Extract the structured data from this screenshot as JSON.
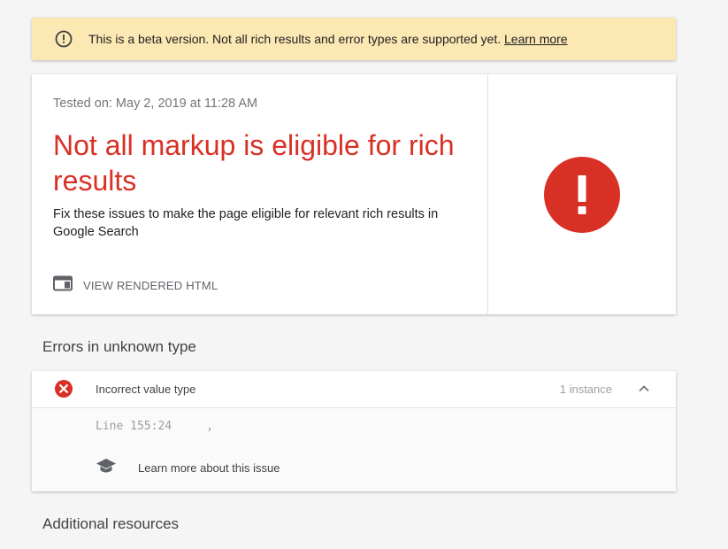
{
  "banner": {
    "icon": "warning-circle-icon",
    "text": "This is a beta version. Not all rich results and error types are supported yet.",
    "link_label": "Learn more"
  },
  "result": {
    "tested_on": "Tested on: May 2, 2019 at 11:28 AM",
    "headline": "Not all markup is eligible for rich results",
    "description": "Fix these issues to make the page eligible for relevant rich results in Google Search",
    "view_html_label": "VIEW RENDERED HTML",
    "view_html_icon": "browser-window-icon",
    "status_icon": "error-exclamation-icon",
    "status_color": "#d93025"
  },
  "errors_section": {
    "title": "Errors in unknown type",
    "issues": [
      {
        "icon": "error-x-icon",
        "title": "Incorrect value type",
        "count": "1 instance",
        "expanded": true,
        "code_line": "Line 155:24     ,",
        "learn_more_icon": "school-cap-icon",
        "learn_more_label": "Learn more about this issue"
      }
    ]
  },
  "additional_section": {
    "title": "Additional resources"
  },
  "colors": {
    "banner_bg": "#fce8b2",
    "error_red": "#d93025",
    "page_bg": "#f5f5f5"
  }
}
